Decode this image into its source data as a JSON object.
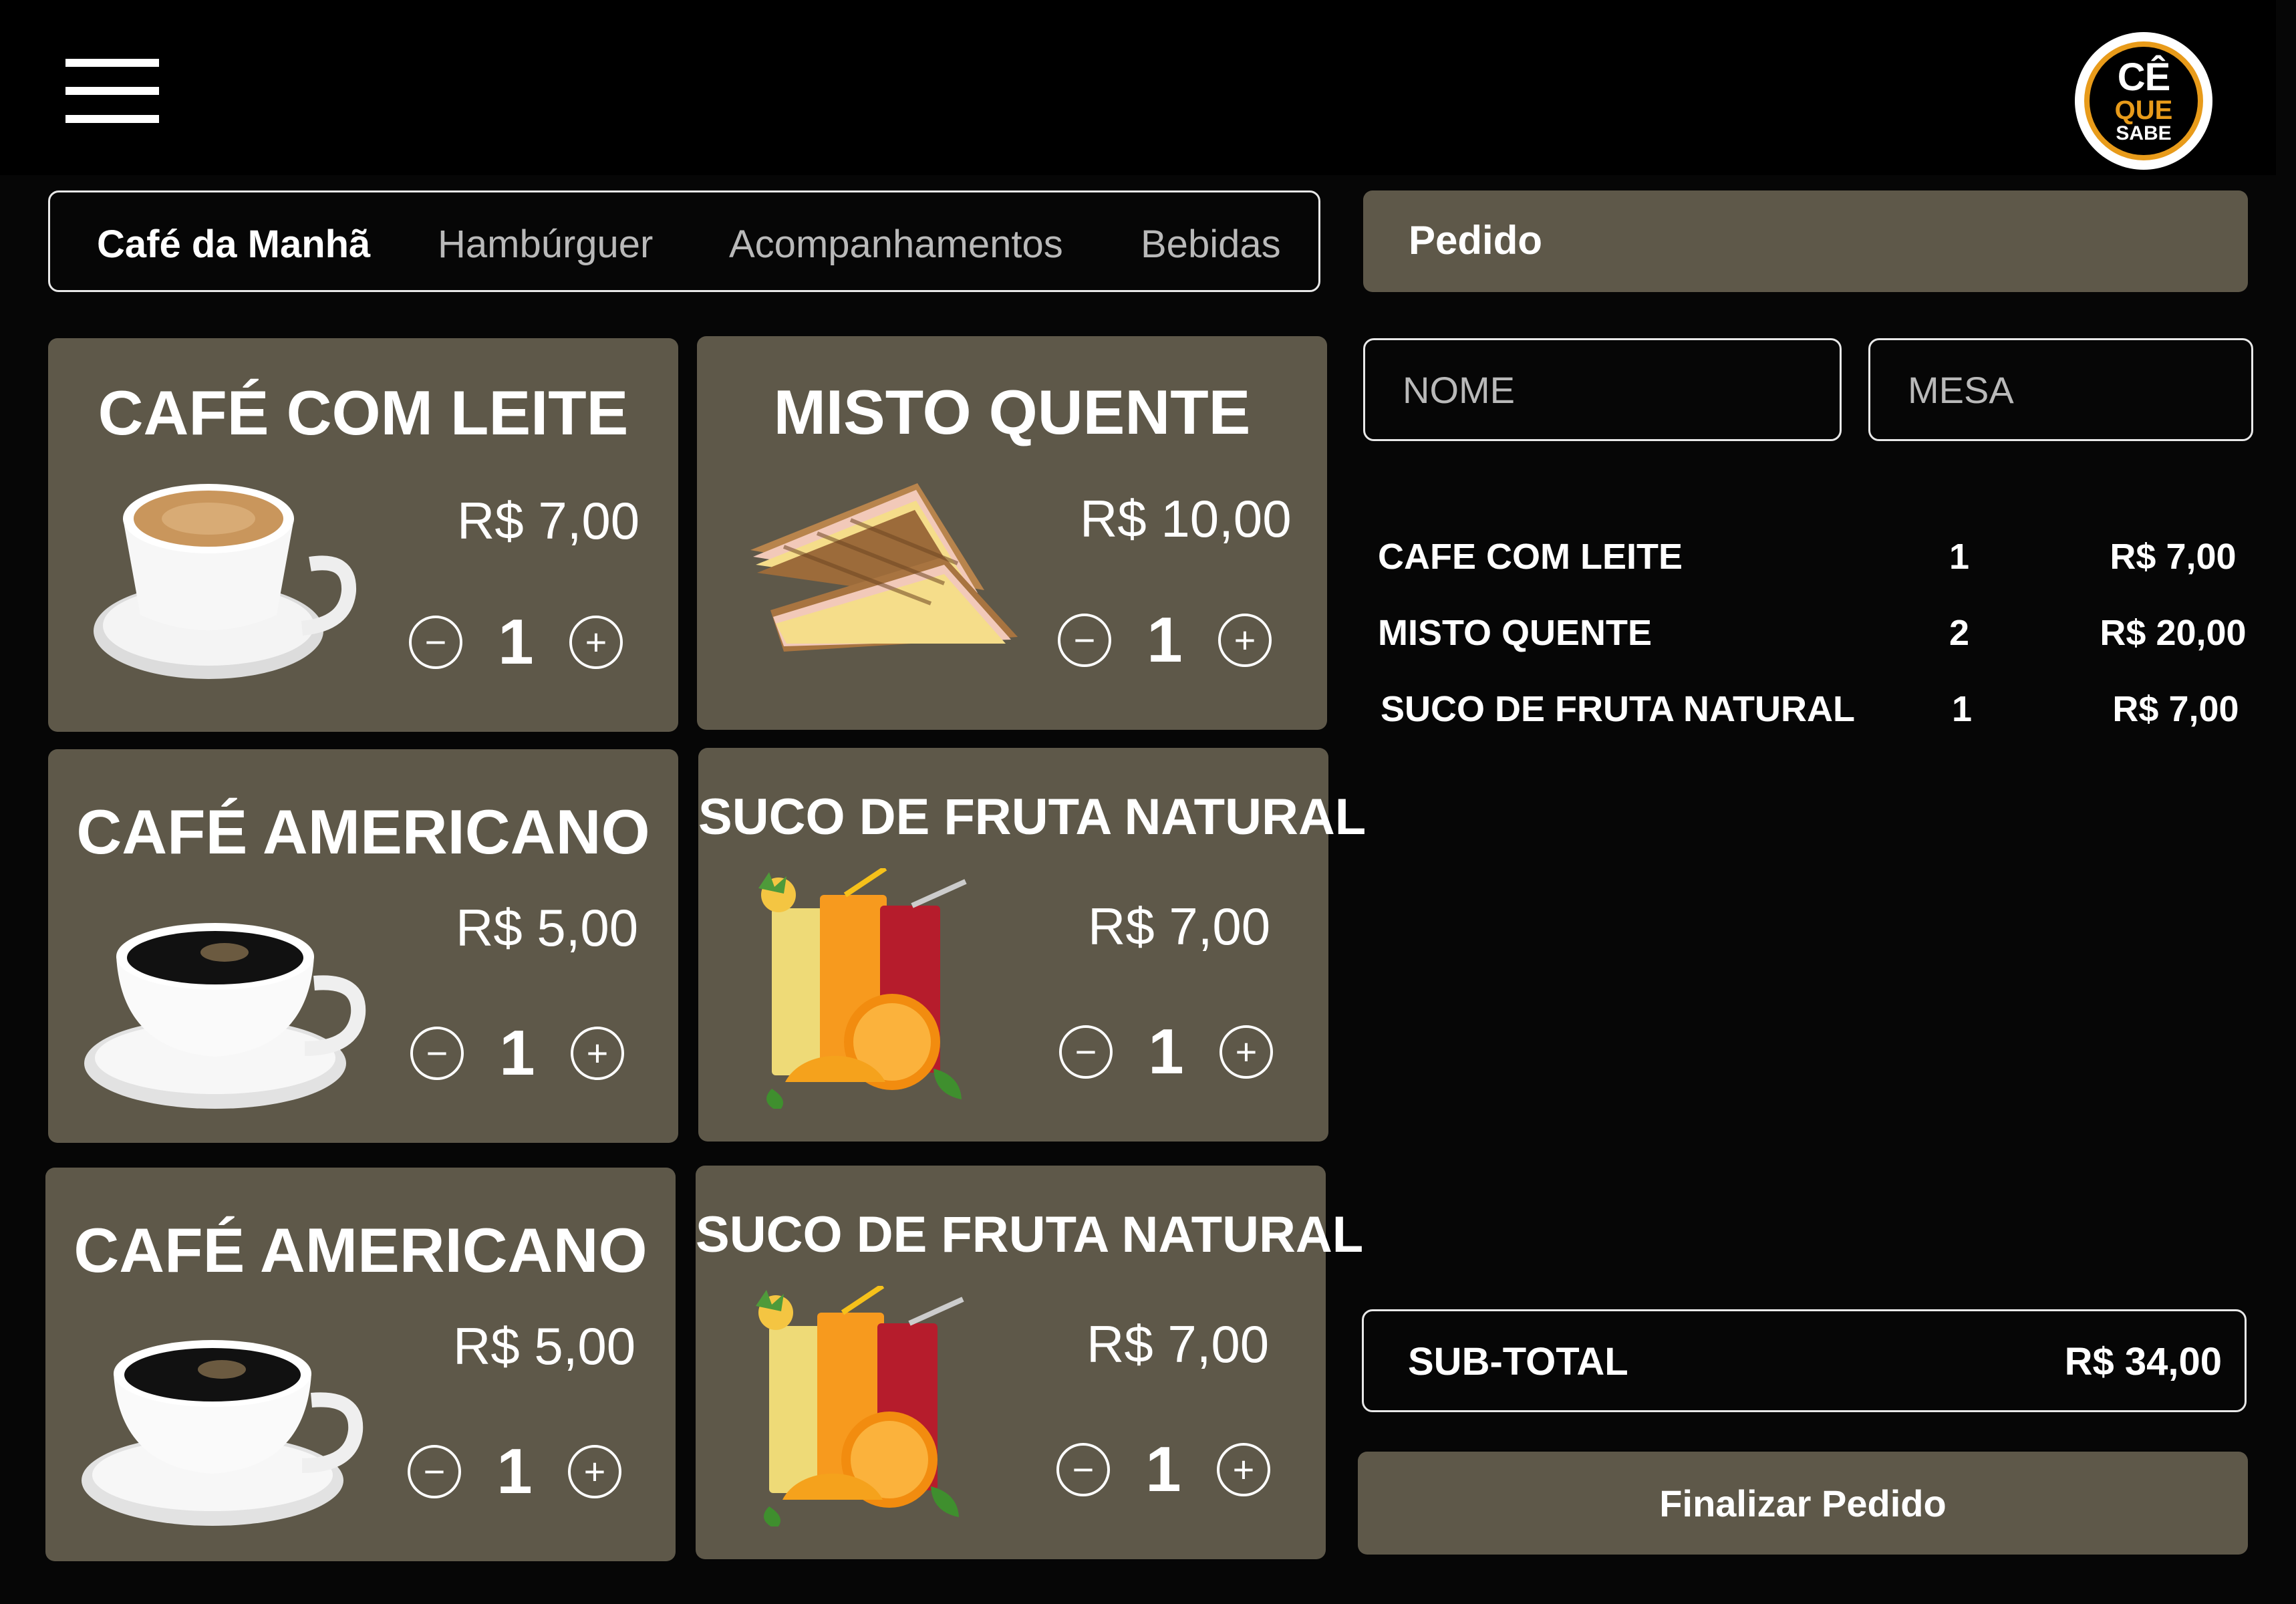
{
  "header": {
    "menu_icon": "hamburger-menu-icon",
    "logo": {
      "line1": "CÊ",
      "line2": "QUE",
      "line3": "SABE"
    }
  },
  "tabs": [
    {
      "label": "Café da Manhã",
      "active": true
    },
    {
      "label": "Hambúrguer",
      "active": false
    },
    {
      "label": "Acompanhamentos",
      "active": false
    },
    {
      "label": "Bebidas",
      "active": false
    }
  ],
  "products": [
    {
      "title": "CAFÉ COM LEITE",
      "price": "R$ 7,00",
      "qty": "1",
      "image": "latte-cup"
    },
    {
      "title": "MISTO QUENTE",
      "price": "R$ 10,00",
      "qty": "1",
      "image": "toasted-sandwich"
    },
    {
      "title": "CAFÉ AMERICANO",
      "price": "R$ 5,00",
      "qty": "1",
      "image": "black-coffee-cup"
    },
    {
      "title": "SUCO DE FRUTA NATURAL",
      "price": "R$ 7,00",
      "qty": "1",
      "image": "juice-glasses"
    },
    {
      "title": "CAFÉ AMERICANO",
      "price": "R$ 5,00",
      "qty": "1",
      "image": "black-coffee-cup"
    },
    {
      "title": "SUCO DE FRUTA NATURAL",
      "price": "R$ 7,00",
      "qty": "1",
      "image": "juice-glasses"
    }
  ],
  "controls": {
    "minus": "−",
    "plus": "+"
  },
  "order": {
    "title": "Pedido",
    "name_placeholder": "NOME",
    "table_placeholder": "MESA",
    "items": [
      {
        "name": "CAFE COM LEITE",
        "qty": "1",
        "price": "R$ 7,00"
      },
      {
        "name": "MISTO QUENTE",
        "qty": "2",
        "price": "R$ 20,00"
      },
      {
        "name": "SUCO DE FRUTA NATURAL",
        "qty": "1",
        "price": "R$ 7,00"
      }
    ],
    "subtotal_label": "SUB-TOTAL",
    "subtotal_value": "R$ 34,00",
    "finish_label": "Finalizar Pedido"
  },
  "colors": {
    "background": "#060606",
    "card": "#5e5849",
    "accent": "#e89b1a"
  }
}
